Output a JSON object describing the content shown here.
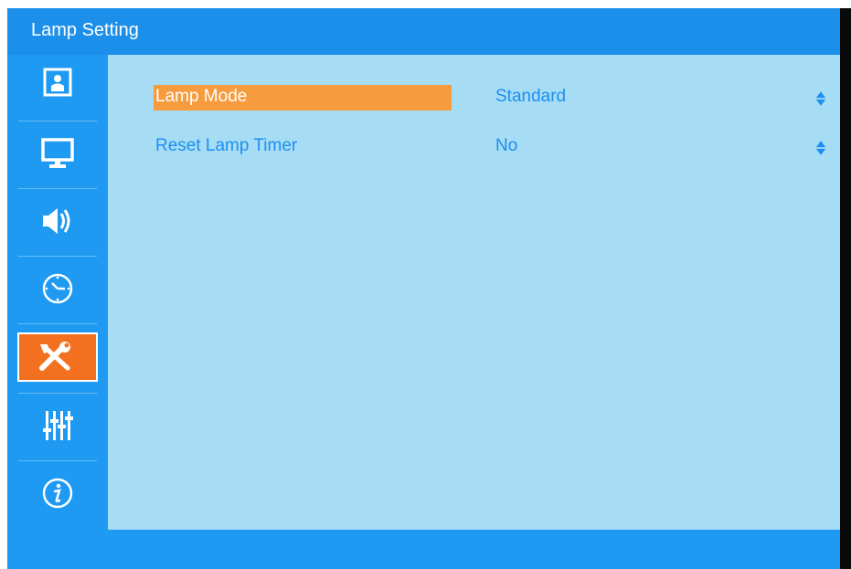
{
  "window": {
    "title": "Lamp Setting"
  },
  "sidebar": {
    "items": [
      {
        "icon": "picture-icon",
        "active": false
      },
      {
        "icon": "display-icon",
        "active": false
      },
      {
        "icon": "speaker-icon",
        "active": false
      },
      {
        "icon": "clock-icon",
        "active": false
      },
      {
        "icon": "tools-icon",
        "active": true
      },
      {
        "icon": "equalizer-icon",
        "active": false
      },
      {
        "icon": "info-icon",
        "active": false
      }
    ]
  },
  "settings": [
    {
      "label": "Lamp Mode",
      "value": "Standard",
      "selected": true
    },
    {
      "label": "Reset Lamp Timer",
      "value": "No",
      "selected": false
    }
  ],
  "colors": {
    "accent": "#f37021",
    "header": "#1c8fea",
    "panel": "#a6dcf4",
    "text": "#1d8ff0",
    "selection": "#f79c3e"
  }
}
